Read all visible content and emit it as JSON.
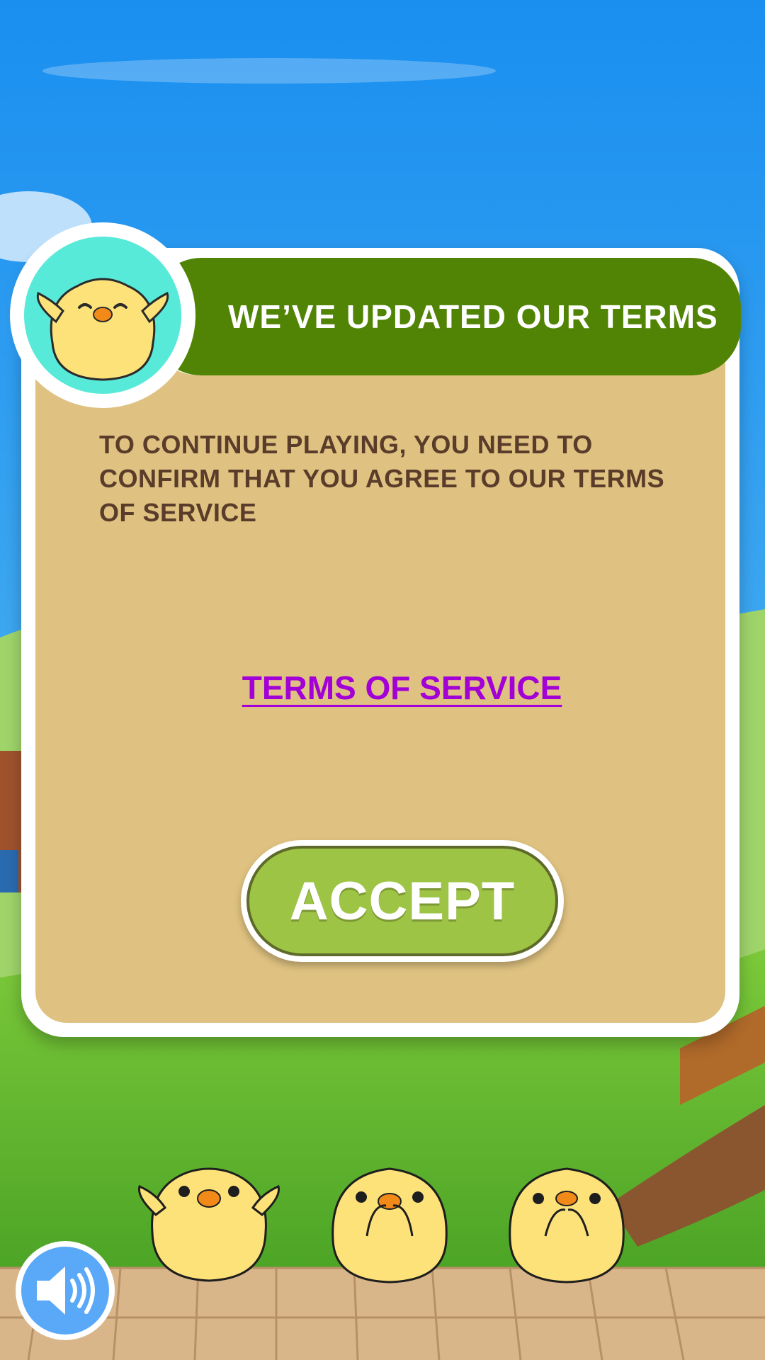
{
  "dialog": {
    "title": "WE’VE UPDATED OUR TERMS",
    "message": "TO CONTINUE PLAYING, YOU NEED TO CONFIRM THAT YOU AGREE TO OUR TERMS OF SERVICE",
    "link_label": "TERMS OF SERVICE",
    "accept_label": "ACCEPT"
  },
  "colors": {
    "header_green": "#518404",
    "panel_tan": "#dfc281",
    "link_purple": "#a200d6",
    "accept_green": "#9ec446",
    "text_brown": "#5a3c2a"
  },
  "icons": {
    "avatar": "happy-chick-icon",
    "sound": "speaker-icon"
  }
}
